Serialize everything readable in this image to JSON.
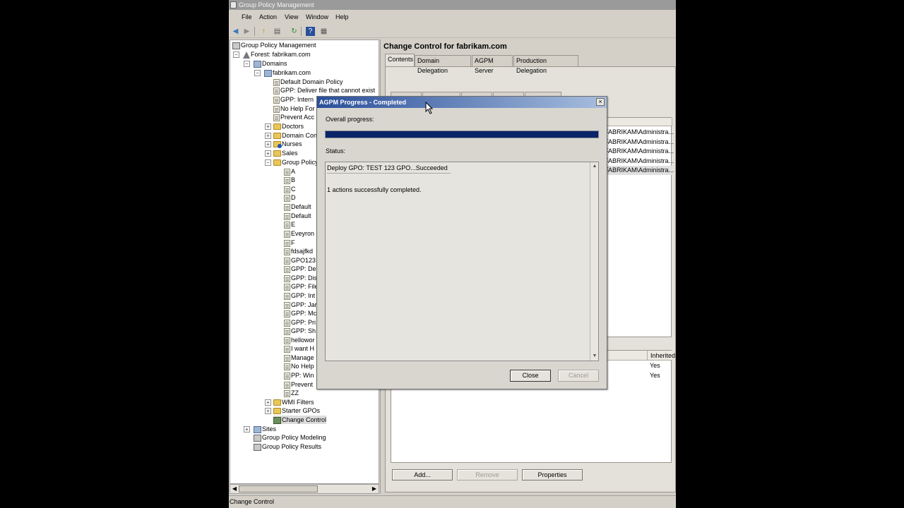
{
  "window": {
    "title": "Group Policy Management"
  },
  "menu": [
    "File",
    "Action",
    "View",
    "Window",
    "Help"
  ],
  "tree": {
    "root": "Group Policy Management",
    "forest": "Forest: fabrikam.com",
    "domains": "Domains",
    "domain": "fabrikam.com",
    "domain_links": [
      "Default Domain Policy",
      "GPP: Deliver file that cannot exist",
      "GPP: Intern",
      "No Help For",
      "Prevent Acc"
    ],
    "ous": [
      "Doctors",
      "Domain Con",
      "Nurses",
      "Sales"
    ],
    "gpo_container": "Group Policy",
    "gpos": [
      "A",
      "B",
      "C",
      "D",
      "Default",
      "Default",
      "E",
      "Eveyron",
      "F",
      "fdsajfkd",
      "GPO123",
      "GPP: De",
      "GPP: Dis",
      "GPP: File",
      "GPP: Int",
      "GPP: Jar",
      "GPP: Mc",
      "GPP: Pri",
      "GPP: Sh",
      "hellowor",
      "I want H",
      "Manage",
      "No Help",
      "PP: Win",
      "Prevent",
      "ZZ"
    ],
    "wmi_filters": "WMI Filters",
    "starter_gpos": "Starter GPOs",
    "change_control": "Change Control",
    "sites": "Sites",
    "modeling": "Group Policy Modeling",
    "results": "Group Policy Results"
  },
  "right": {
    "title": "Change Control for fabrikam.com",
    "tabs": [
      "Contents",
      "Domain Delegation",
      "AGPM Server",
      "Production Delegation"
    ],
    "owner_rows": [
      "FABRIKAM\\Administra...",
      "FABRIKAM\\Administra...",
      "FABRIKAM\\Administra...",
      "FABRIKAM\\Administra...",
      "FABRIKAM\\Administra..."
    ],
    "bottom_header": "Inherited",
    "bottom_rows": [
      "Yes",
      "Yes"
    ],
    "buttons": {
      "add": "Add...",
      "remove": "Remove",
      "properties": "Properties"
    }
  },
  "status_bar": "Change Control",
  "dialog": {
    "title": "AGPM Progress - Completed",
    "overall_label": "Overall progress:",
    "progress": 1.0,
    "status_label": "Status:",
    "status_line1": "Deploy GPO: TEST 123 GPO...Succeeded",
    "status_line2": "1 actions successfully completed.",
    "close_label": "Close",
    "cancel_label": "Cancel",
    "close_glyph": "×"
  },
  "colors": {
    "progress_fill": "#0a246a",
    "dialog_title": "#2a4f9a"
  }
}
